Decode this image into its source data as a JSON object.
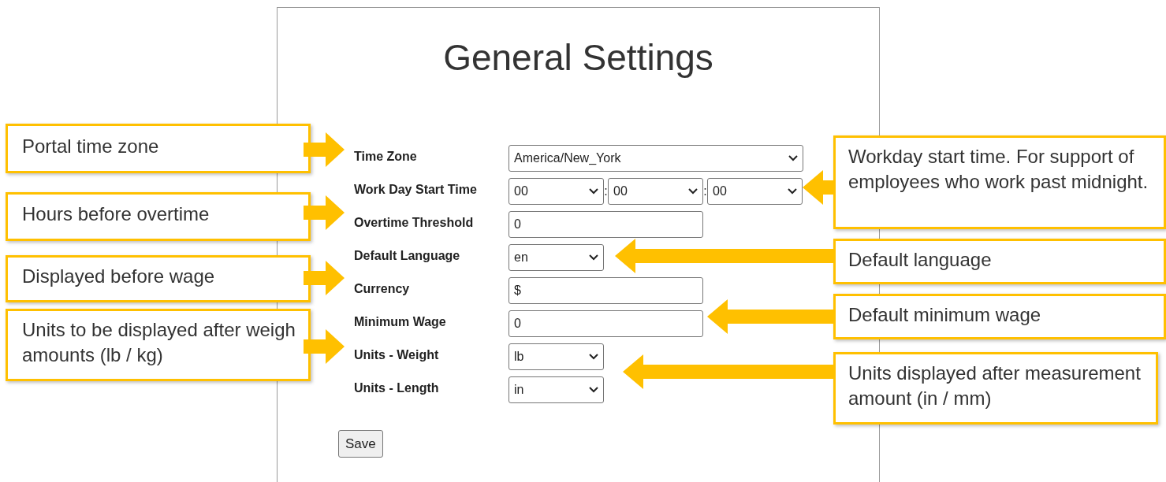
{
  "panel": {
    "title": "General Settings",
    "fields": [
      {
        "label": "Time Zone",
        "kind": "wide_select",
        "value": "America/New_York"
      },
      {
        "label": "Work Day Start Time",
        "kind": "time",
        "values": [
          "00",
          "00",
          "00"
        ],
        "separator": ":"
      },
      {
        "label": "Overtime Threshold",
        "kind": "text",
        "value": "0"
      },
      {
        "label": "Default Language",
        "kind": "short_select",
        "value": "en"
      },
      {
        "label": "Currency",
        "kind": "text",
        "value": "$"
      },
      {
        "label": "Minimum Wage",
        "kind": "text",
        "value": "0"
      },
      {
        "label": "Units - Weight",
        "kind": "short_select",
        "value": "lb"
      },
      {
        "label": "Units - Length",
        "kind": "short_select",
        "value": "in"
      }
    ],
    "save_button": "Save"
  },
  "callouts_left": [
    {
      "text": "Portal time zone"
    },
    {
      "text": "Hours before overtime"
    },
    {
      "text": "Displayed before wage"
    },
    {
      "text": "Units to be displayed after weigh amounts (lb / kg)"
    }
  ],
  "callouts_right": [
    {
      "text": "Workday start time. For support of employees who work past midnight."
    },
    {
      "text": "Default language"
    },
    {
      "text": "Default minimum wage"
    },
    {
      "text": "Units displayed after measurement amount (in / mm)"
    }
  ]
}
